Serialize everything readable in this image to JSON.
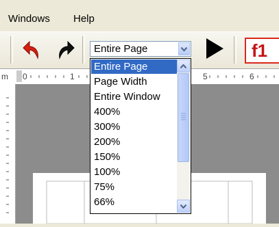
{
  "menu": [
    "Windows",
    "Help"
  ],
  "toolbar": {
    "undo_icon": "undo-arrow-icon",
    "redo_icon": "redo-arrow-icon",
    "play_icon": "play-triangle-icon",
    "fn_label": "f1"
  },
  "zoom": {
    "selected": "Entire Page",
    "options": [
      "Entire Page",
      "Page Width",
      "Entire Window",
      "400%",
      "300%",
      "200%",
      "150%",
      "100%",
      "75%",
      "66%"
    ]
  },
  "ruler": {
    "left_labels": [
      "m",
      "0",
      "1"
    ],
    "right_labels": [
      "5",
      "6"
    ]
  },
  "colors": {
    "selection": "#316ac5",
    "fn_red": "#c21616"
  }
}
